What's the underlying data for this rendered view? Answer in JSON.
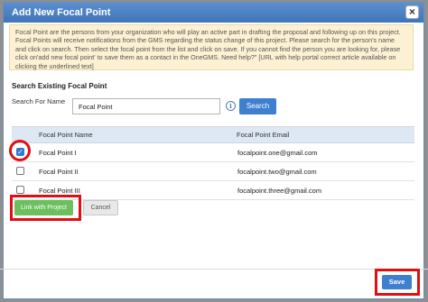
{
  "dialog": {
    "title": "Add New Focal Point",
    "close_glyph": "×",
    "notice": "Focal Point are the persons from your organization who will play an active part in drafting the proposal and following up on this project. Focal Points will receive notifications from the GMS regarding the status change of this project. Please search for the person's name and click on search. Then select the focal point from the list and click on save. If you cannot find the person you are looking for, please click on'add new focal point' to save them as a contact in the OneGMS. Need help?\" [URL with help portal correct article available on clicking the underlined text]"
  },
  "search": {
    "section_title": "Search Existing Focal Point",
    "label": "Search For Name",
    "value": "Focal Point",
    "button_label": "Search",
    "info_glyph": "i"
  },
  "table": {
    "headers": {
      "name": "Focal Point Name",
      "email": "Focal Point Email"
    },
    "rows": [
      {
        "name": "Focal Point I",
        "email": "focalpoint.one@gmail.com",
        "checked": true
      },
      {
        "name": "Focal Point II",
        "email": "focalpoint.two@gmail.com",
        "checked": false
      },
      {
        "name": "Focal Point III",
        "email": "focalpoint.three@gmail.com",
        "checked": false
      }
    ]
  },
  "actions": {
    "link_label": "Link with Project",
    "cancel_label": "Cancel",
    "save_label": "Save",
    "check_glyph": "✓"
  },
  "colors": {
    "titlebar": "#3f74b8",
    "primary_button": "#3f7fcf",
    "link_button": "#6bbf5e",
    "highlight": "#e01010",
    "notice_bg": "#fcf1d3"
  }
}
